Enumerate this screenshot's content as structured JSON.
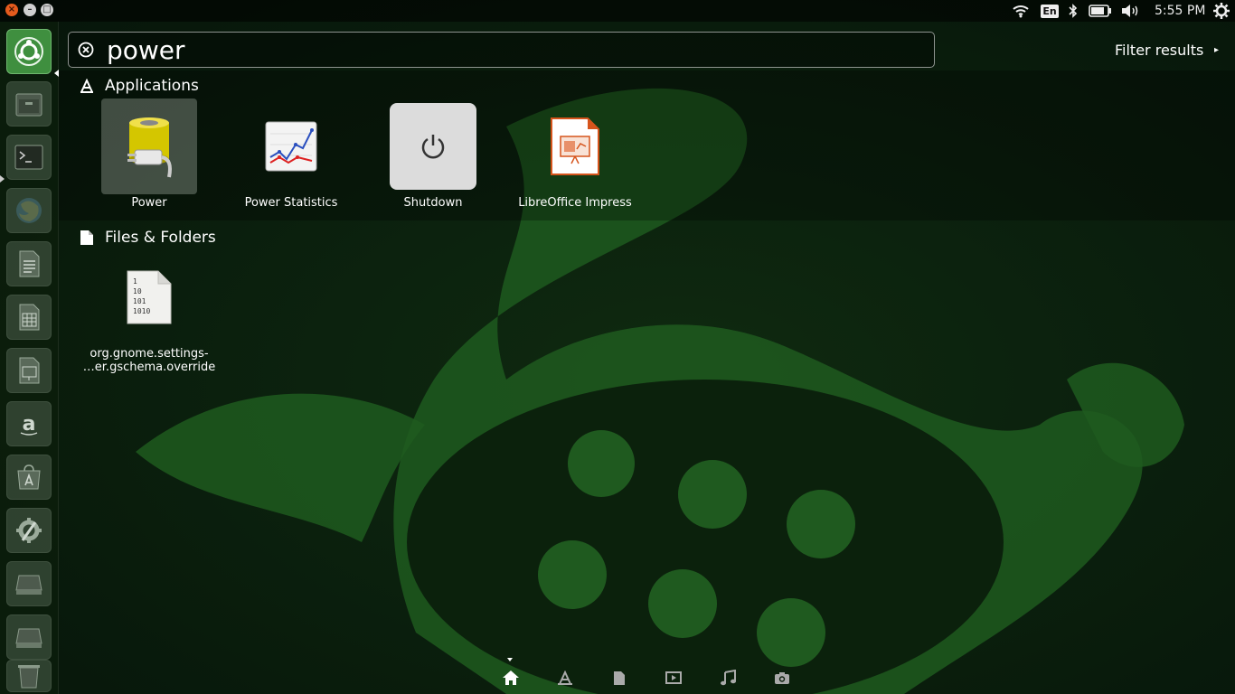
{
  "window_controls": {
    "close": "×",
    "minimize": "–",
    "maximize": "□"
  },
  "panel": {
    "keyboard_layout": "En",
    "time": "5:55 PM"
  },
  "search": {
    "value": "power",
    "filter_label": "Filter results",
    "filter_arrow": "▸"
  },
  "categories": [
    {
      "name": "Applications",
      "items": [
        {
          "label": "Power",
          "icon": "power-battery-icon"
        },
        {
          "label": "Power Statistics",
          "icon": "power-statistics-icon"
        },
        {
          "label": "Shutdown",
          "icon": "shutdown-icon"
        },
        {
          "label": "LibreOffice Impress",
          "icon": "libreoffice-impress-icon"
        }
      ]
    },
    {
      "name": "Files & Folders",
      "items": [
        {
          "label_line1": "org.gnome.settings-",
          "label_line2": "…er.gschema.override",
          "icon": "binary-file-icon",
          "icon_text": [
            "1",
            "10",
            "101",
            "1010"
          ]
        }
      ]
    }
  ],
  "launcher": [
    "dash-home-icon",
    "files-icon",
    "terminal-icon",
    "firefox-icon",
    "libreoffice-writer-icon",
    "libreoffice-calc-icon",
    "libreoffice-impress-icon",
    "amazon-icon",
    "software-center-icon",
    "system-settings-icon",
    "drive-icon",
    "drive-icon",
    "trash-icon"
  ],
  "lens_bar": [
    "home-lens-icon",
    "applications-lens-icon",
    "files-lens-icon",
    "video-lens-icon",
    "music-lens-icon",
    "photo-lens-icon"
  ],
  "colors": {
    "accent": "#3f8f3f",
    "wallpaper": "#1f5a1f",
    "panel": "#000000"
  }
}
